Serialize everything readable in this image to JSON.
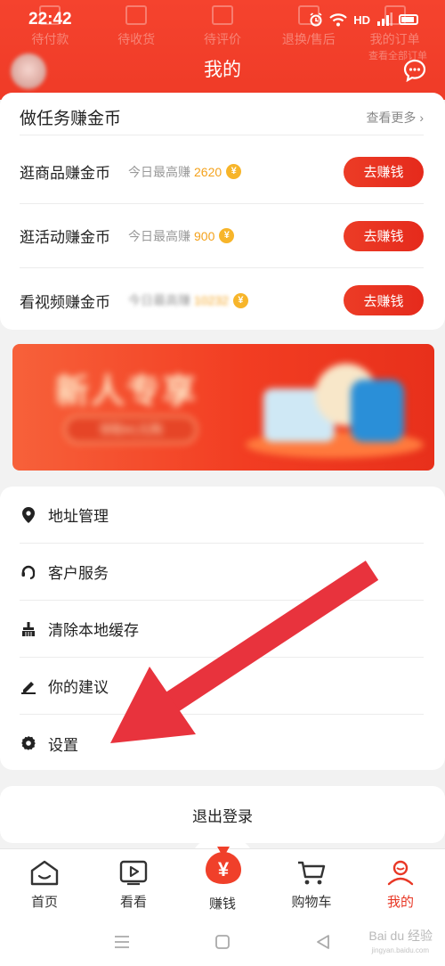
{
  "status_bar": {
    "time": "22:42",
    "network": "HD"
  },
  "header_ghost": {
    "items": [
      "待付款",
      "待收货",
      "待评价",
      "退换/售后",
      "我的订单"
    ],
    "sub": "查看全部订单"
  },
  "header": {
    "title": "我的"
  },
  "earn": {
    "title": "做任务赚金币",
    "more": "查看更多 ›",
    "rows": [
      {
        "label": "逛商品赚金币",
        "sub": "今日最高赚",
        "value": "2620",
        "button": "去赚钱"
      },
      {
        "label": "逛活动赚金币",
        "sub": "今日最高赚",
        "value": "900",
        "button": "去赚钱"
      },
      {
        "label": "看视频赚金币",
        "sub": "今日最高赚",
        "value": "10232",
        "button": "去赚钱"
      }
    ],
    "coin_symbol": "¥"
  },
  "banner": {
    "title": "新人专享",
    "pill": "领取¥1元购"
  },
  "settings": {
    "items": [
      {
        "label": "地址管理",
        "icon": "location-pin-icon"
      },
      {
        "label": "客户服务",
        "icon": "headset-icon"
      },
      {
        "label": "清除本地缓存",
        "icon": "broom-icon"
      },
      {
        "label": "你的建议",
        "icon": "pencil-icon"
      },
      {
        "label": "设置",
        "icon": "gear-icon"
      }
    ]
  },
  "logout": {
    "label": "退出登录"
  },
  "tabbar": {
    "items": [
      {
        "label": "首页",
        "icon": "home-icon"
      },
      {
        "label": "看看",
        "icon": "video-icon"
      },
      {
        "label": "赚钱",
        "icon": "money-bag-icon"
      },
      {
        "label": "购物车",
        "icon": "cart-icon"
      },
      {
        "label": "我的",
        "icon": "profile-icon"
      }
    ],
    "active": "我的",
    "bag_symbol": "¥"
  },
  "watermark": {
    "text": "Bai du 经验",
    "sub": "jingyan.baidu.com"
  },
  "colors": {
    "brand_red": "#ef3b27",
    "coin": "#f7b52a",
    "arrow": "#e8333d"
  }
}
